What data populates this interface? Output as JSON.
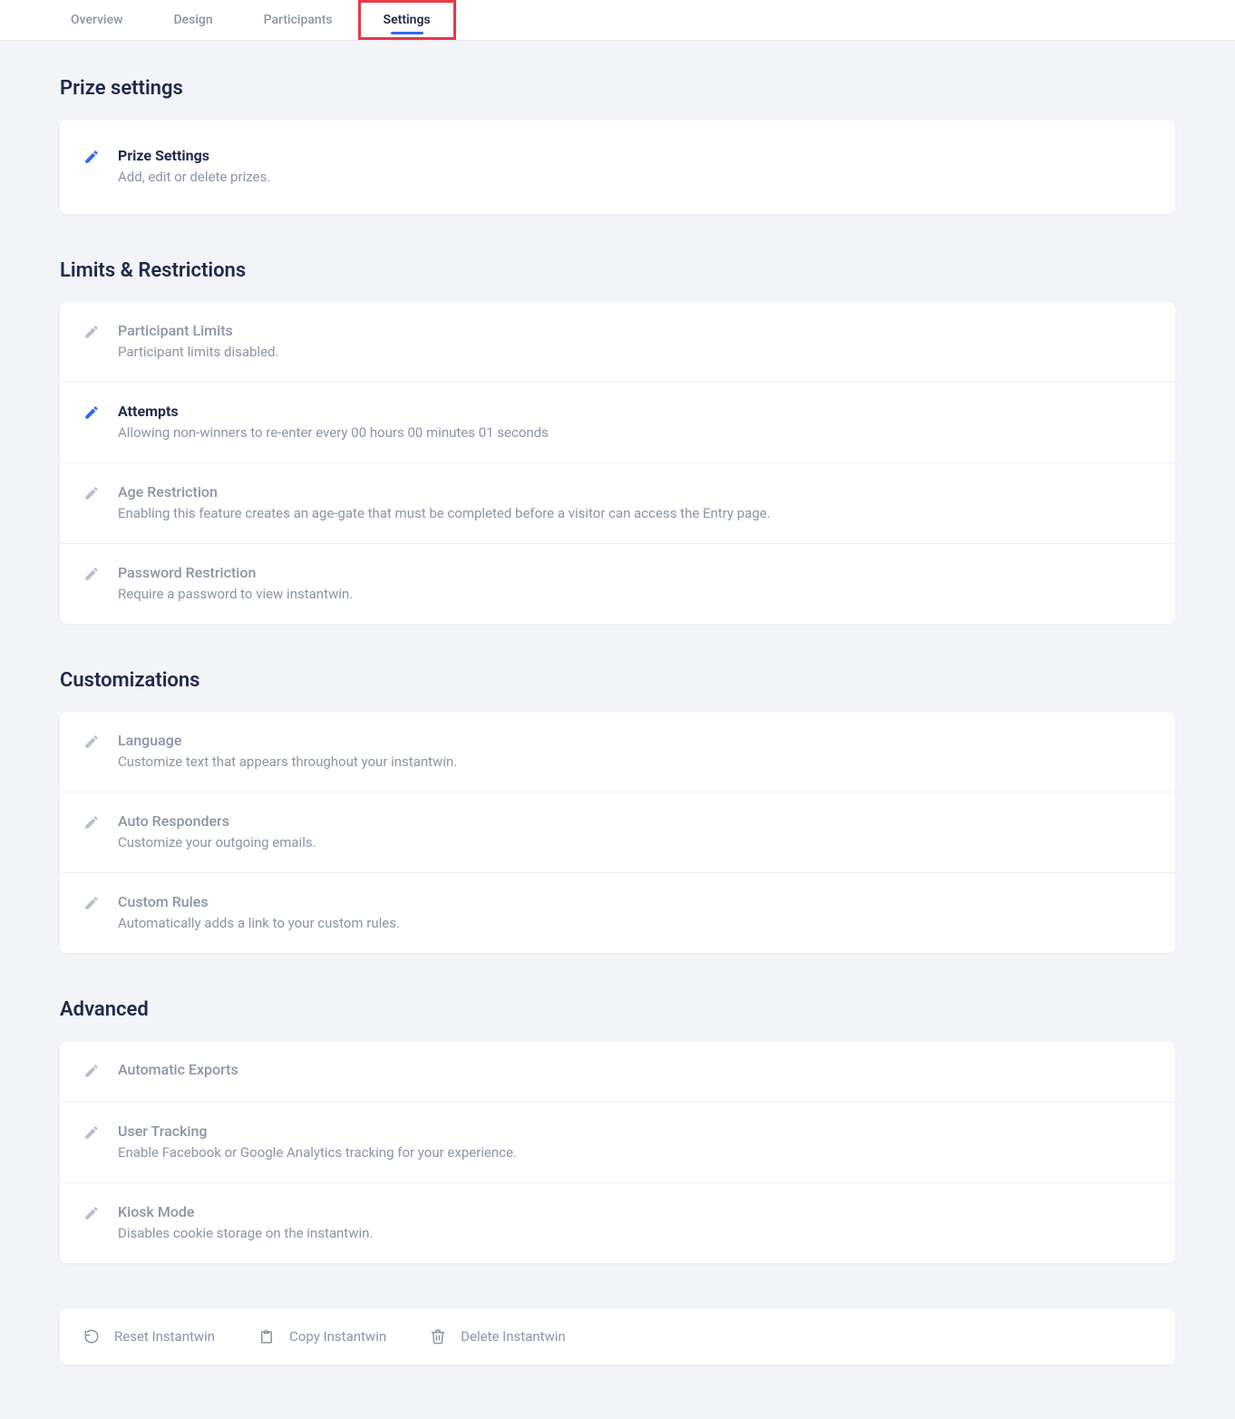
{
  "tabs": [
    {
      "label": "Overview",
      "active": false
    },
    {
      "label": "Design",
      "active": false
    },
    {
      "label": "Participants",
      "active": false
    },
    {
      "label": "Settings",
      "active": true,
      "highlighted": true
    }
  ],
  "sections": {
    "prize": {
      "heading": "Prize settings",
      "items": [
        {
          "title": "Prize Settings",
          "sub": "Add, edit or delete prizes.",
          "strong": true,
          "iconActive": true
        }
      ]
    },
    "limits": {
      "heading": "Limits & Restrictions",
      "items": [
        {
          "title": "Participant Limits",
          "sub": "Participant limits disabled.",
          "strong": false,
          "iconActive": false
        },
        {
          "title": "Attempts",
          "sub": "Allowing non-winners to re-enter every 00 hours 00 minutes 01 seconds",
          "strong": true,
          "iconActive": true
        },
        {
          "title": "Age Restriction",
          "sub": "Enabling this feature creates an age-gate that must be completed before a visitor can access the Entry page.",
          "strong": false,
          "iconActive": false
        },
        {
          "title": "Password Restriction",
          "sub": "Require a password to view instantwin.",
          "strong": false,
          "iconActive": false
        }
      ]
    },
    "customizations": {
      "heading": "Customizations",
      "items": [
        {
          "title": "Language",
          "sub": "Customize text that appears throughout your instantwin.",
          "strong": false,
          "iconActive": false
        },
        {
          "title": "Auto Responders",
          "sub": "Customize your outgoing emails.",
          "strong": false,
          "iconActive": false
        },
        {
          "title": "Custom Rules",
          "sub": "Automatically adds a link to your custom rules.",
          "strong": false,
          "iconActive": false
        }
      ]
    },
    "advanced": {
      "heading": "Advanced",
      "items": [
        {
          "title": "Automatic Exports",
          "sub": "",
          "strong": false,
          "iconActive": false
        },
        {
          "title": "User Tracking",
          "sub": "Enable Facebook or Google Analytics tracking for your experience.",
          "strong": false,
          "iconActive": false
        },
        {
          "title": "Kiosk Mode",
          "sub": "Disables cookie storage on the instantwin.",
          "strong": false,
          "iconActive": false
        }
      ]
    }
  },
  "actions": {
    "reset": "Reset Instantwin",
    "copy": "Copy Instantwin",
    "delete": "Delete Instantwin"
  }
}
